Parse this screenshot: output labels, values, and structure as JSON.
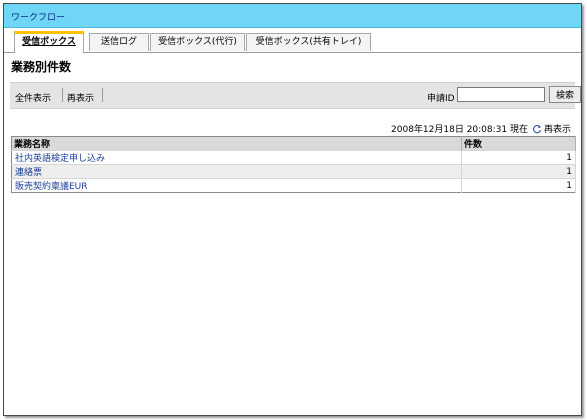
{
  "window": {
    "title": "ワークフロー"
  },
  "tabs": [
    {
      "label": "受信ボックス",
      "active": true
    },
    {
      "label": "送信ログ",
      "active": false
    },
    {
      "label": "受信ボックス(代行)",
      "active": false
    },
    {
      "label": "受信ボックス(共有トレイ)",
      "active": false
    }
  ],
  "page_title": "業務別件数",
  "toolbar": {
    "show_all": "全件表示",
    "redisplay": "再表示",
    "request_id_label": "申請ID",
    "request_id_value": "",
    "search_button": "検索"
  },
  "status": {
    "timestamp": "2008年12月18日 20:08:31 現在",
    "refresh_label": "再表示"
  },
  "table": {
    "headers": {
      "name": "業務名称",
      "count": "件数"
    },
    "rows": [
      {
        "name": "社内英語検定申し込み",
        "count": "1"
      },
      {
        "name": "連絡票",
        "count": "1"
      },
      {
        "name": "販売契約稟議EUR",
        "count": "1"
      }
    ]
  },
  "colors": {
    "titlebar": "#6fd6f5",
    "active_tab_accent": "#ffc000",
    "link": "#1b3f9a"
  }
}
